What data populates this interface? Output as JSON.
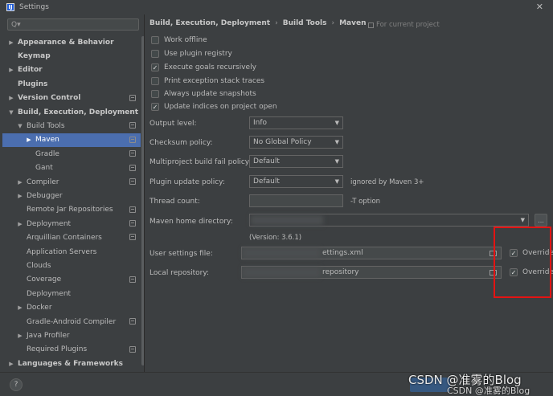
{
  "window": {
    "title": "Settings",
    "app_icon": "intellij-icon",
    "close": "✕"
  },
  "sidebar": {
    "search_placeholder": "Q▾",
    "items": [
      {
        "label": "Appearance & Behavior",
        "arrow": "▶",
        "level": 0,
        "bold": true,
        "proj": false
      },
      {
        "label": "Keymap",
        "arrow": "",
        "level": 0,
        "bold": true,
        "proj": false
      },
      {
        "label": "Editor",
        "arrow": "▶",
        "level": 0,
        "bold": true,
        "proj": false
      },
      {
        "label": "Plugins",
        "arrow": "",
        "level": 0,
        "bold": true,
        "proj": false
      },
      {
        "label": "Version Control",
        "arrow": "▶",
        "level": 0,
        "bold": true,
        "proj": true
      },
      {
        "label": "Build, Execution, Deployment",
        "arrow": "▼",
        "level": 0,
        "bold": true,
        "proj": false
      },
      {
        "label": "Build Tools",
        "arrow": "▼",
        "level": 1,
        "bold": false,
        "proj": true
      },
      {
        "label": "Maven",
        "arrow": "▶",
        "level": 2,
        "bold": false,
        "proj": true,
        "selected": true
      },
      {
        "label": "Gradle",
        "arrow": "",
        "level": 2,
        "bold": false,
        "proj": true
      },
      {
        "label": "Gant",
        "arrow": "",
        "level": 2,
        "bold": false,
        "proj": true
      },
      {
        "label": "Compiler",
        "arrow": "▶",
        "level": 1,
        "bold": false,
        "proj": true
      },
      {
        "label": "Debugger",
        "arrow": "▶",
        "level": 1,
        "bold": false,
        "proj": false
      },
      {
        "label": "Remote Jar Repositories",
        "arrow": "",
        "level": 1,
        "bold": false,
        "proj": true
      },
      {
        "label": "Deployment",
        "arrow": "▶",
        "level": 1,
        "bold": false,
        "proj": true
      },
      {
        "label": "Arquillian Containers",
        "arrow": "",
        "level": 1,
        "bold": false,
        "proj": true
      },
      {
        "label": "Application Servers",
        "arrow": "",
        "level": 1,
        "bold": false,
        "proj": false
      },
      {
        "label": "Clouds",
        "arrow": "",
        "level": 1,
        "bold": false,
        "proj": false
      },
      {
        "label": "Coverage",
        "arrow": "",
        "level": 1,
        "bold": false,
        "proj": true
      },
      {
        "label": "Deployment",
        "arrow": "",
        "level": 1,
        "bold": false,
        "proj": false
      },
      {
        "label": "Docker",
        "arrow": "▶",
        "level": 1,
        "bold": false,
        "proj": false
      },
      {
        "label": "Gradle-Android Compiler",
        "arrow": "",
        "level": 1,
        "bold": false,
        "proj": true
      },
      {
        "label": "Java Profiler",
        "arrow": "▶",
        "level": 1,
        "bold": false,
        "proj": false
      },
      {
        "label": "Required Plugins",
        "arrow": "",
        "level": 1,
        "bold": false,
        "proj": true
      },
      {
        "label": "Languages & Frameworks",
        "arrow": "▶",
        "level": 0,
        "bold": true,
        "proj": false
      }
    ]
  },
  "breadcrumb": {
    "parts": [
      "Build, Execution, Deployment",
      "Build Tools",
      "Maven"
    ],
    "separator": "›",
    "for_project": "For current project"
  },
  "checkboxes": [
    {
      "label": "Work offline",
      "checked": false
    },
    {
      "label": "Use plugin registry",
      "checked": false
    },
    {
      "label": "Execute goals recursively",
      "checked": true
    },
    {
      "label": "Print exception stack traces",
      "checked": false
    },
    {
      "label": "Always update snapshots",
      "checked": false
    },
    {
      "label": "Update indices on project open",
      "checked": true
    }
  ],
  "fields": {
    "output_level": {
      "label": "Output level:",
      "value": "Info"
    },
    "checksum_policy": {
      "label": "Checksum policy:",
      "value": "No Global Policy"
    },
    "multiproject_fail": {
      "label": "Multiproject build fail policy:",
      "value": "Default"
    },
    "plugin_update": {
      "label": "Plugin update policy:",
      "value": "Default",
      "hint": "ignored by Maven 3+"
    },
    "thread_count": {
      "label": "Thread count:",
      "value": "",
      "hint": "-T option"
    },
    "maven_home": {
      "label": "Maven home directory:",
      "value": "",
      "version": "(Version: 3.6.1)",
      "browse": "..."
    },
    "user_settings": {
      "label": "User settings file:",
      "value": "ettings.xml",
      "override": "Override",
      "override_checked": true
    },
    "local_repo": {
      "label": "Local repository:",
      "value": "repository",
      "override": "Override",
      "override_checked": true
    }
  },
  "footer": {
    "help": "?"
  },
  "watermark": {
    "text": "CSDN @准雾的Blog",
    "text2": "CSDN @准雾的Blog"
  },
  "colors": {
    "highlight_box": "#e41313",
    "selection": "#4b6eaf"
  }
}
